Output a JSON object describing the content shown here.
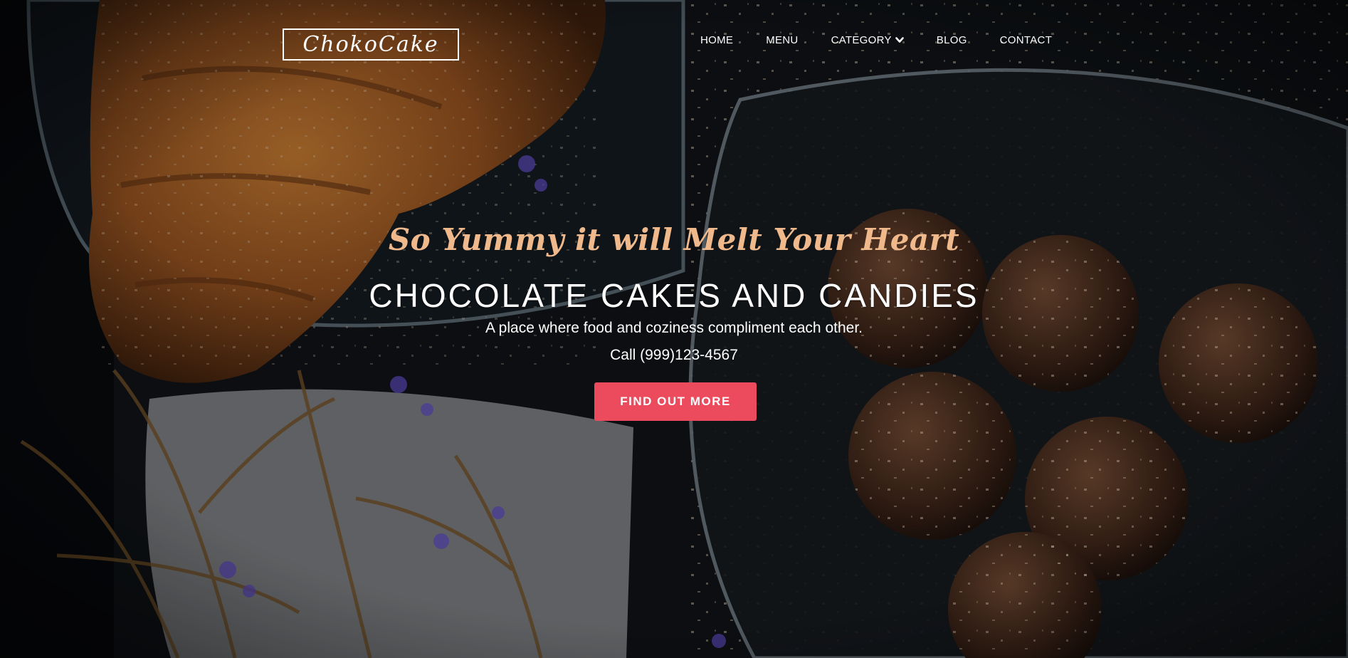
{
  "brand": {
    "logo_text": "ChokoCake"
  },
  "nav": {
    "items": [
      {
        "label": "HOME"
      },
      {
        "label": "MENU"
      },
      {
        "label": "CATEGORY",
        "icon": "chevron-down-icon"
      },
      {
        "label": "BLOG"
      },
      {
        "label": "CONTACT"
      }
    ]
  },
  "hero": {
    "tagline": "So Yummy it will Melt Your Heart",
    "headline": "CHOCOLATE CAKES AND CANDIES",
    "subline": "A place where food and coziness compliment each other.",
    "phone": "Call (999)123-4567",
    "cta_label": "FIND OUT MORE"
  },
  "colors": {
    "accent": "#ec4a5d",
    "tagline": "#f0b98c",
    "background": "#0d1014"
  }
}
